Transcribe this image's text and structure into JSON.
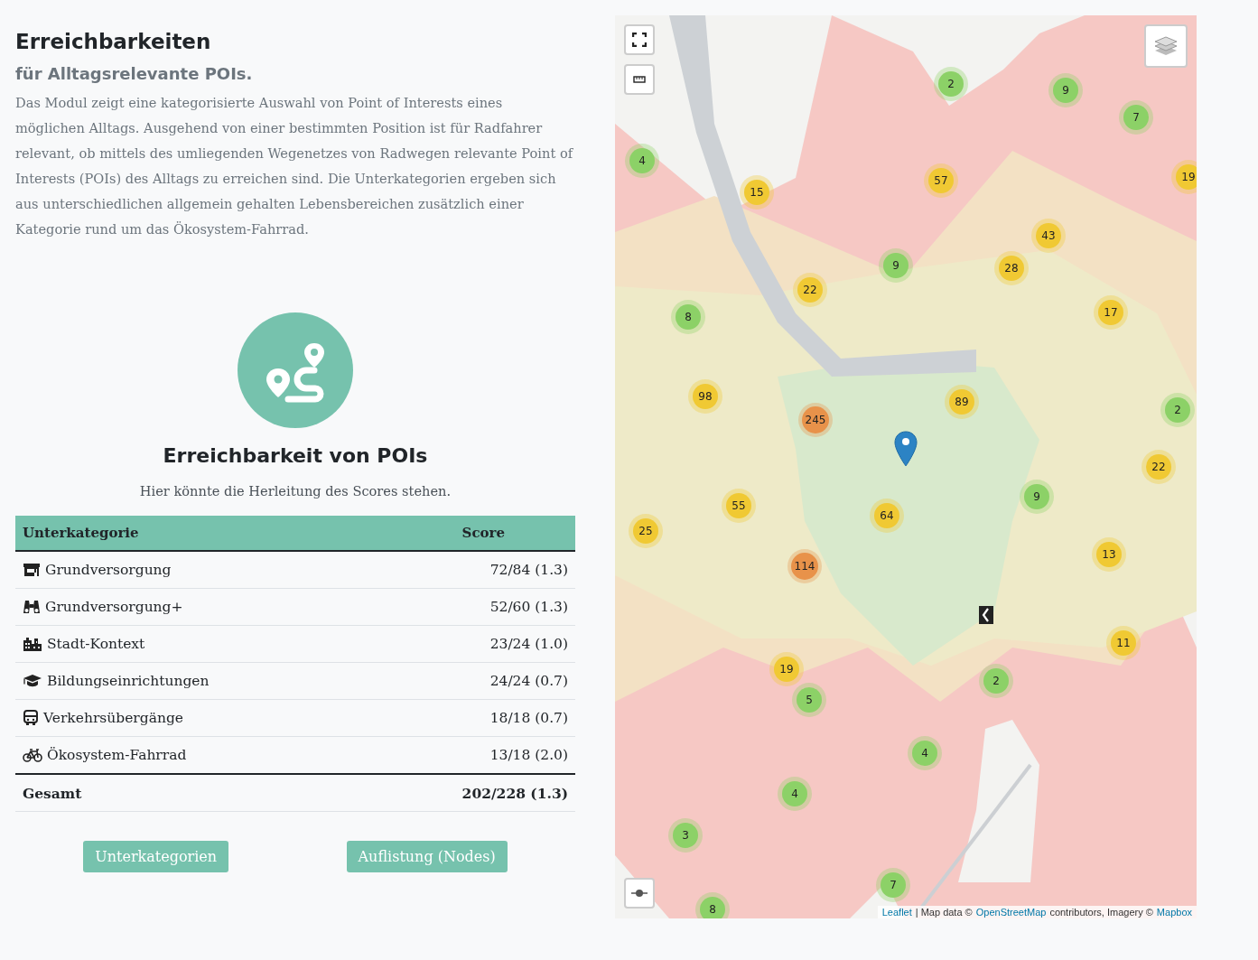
{
  "header": {
    "title": "Erreichbarkeiten",
    "subtitle": "für Alltagsrelevante POIs.",
    "description": "Das Modul zeigt eine kategorisierte Auswahl von Point of Interests eines möglichen Alltags. Ausgehend von einer bestimmten Position ist für Radfahrer relevant, ob mittels des umliegenden Wegenetzes von Radwegen relevante Point of Interests (POIs) des Alltags zu erreichen sind. Die Unterkategorien ergeben sich aus unterschiedlichen allgemein gehalten Lebensbereichen zusätzlich einer Kategorie rund um das Ökosystem-Fahrrad."
  },
  "score_card": {
    "title": "Erreichbarkeit von POIs",
    "note": "Hier könnte die Herleitung des Scores stehen."
  },
  "table": {
    "columns": [
      "Unterkategorie",
      "Score"
    ],
    "rows": [
      {
        "name": "Grundversorgung",
        "score": "72/84 (1.3)"
      },
      {
        "name": "Grundversorgung+",
        "score": "52/60 (1.3)"
      },
      {
        "name": "Stadt-Kontext",
        "score": "23/24 (1.0)"
      },
      {
        "name": "Bildungseinrichtungen",
        "score": "24/24 (0.7)"
      },
      {
        "name": "Verkehrsübergänge",
        "score": "18/18 (0.7)"
      },
      {
        "name": "Ökosystem-Fahrrad",
        "score": "13/18 (2.0)"
      }
    ],
    "total": {
      "name": "Gesamt",
      "score": "202/228 (1.3)"
    }
  },
  "buttons": [
    "Unterkategorien",
    "Auflistung (Nodes)"
  ],
  "map": {
    "clusters": [
      {
        "label": "2",
        "color": "#8cd167"
      },
      {
        "label": "9",
        "color": "#8cd167"
      },
      {
        "label": "7",
        "color": "#8cd167"
      },
      {
        "label": "4",
        "color": "#8cd167"
      },
      {
        "label": "15",
        "color": "#f0c933"
      },
      {
        "label": "57",
        "color": "#f0c933"
      },
      {
        "label": "19",
        "color": "#f0c933"
      },
      {
        "label": "43",
        "color": "#f0c933"
      },
      {
        "label": "9",
        "color": "#8cd167"
      },
      {
        "label": "28",
        "color": "#f0c933"
      },
      {
        "label": "22",
        "color": "#f0c933"
      },
      {
        "label": "8",
        "color": "#8cd167"
      },
      {
        "label": "17",
        "color": "#f0c933"
      },
      {
        "label": "98",
        "color": "#f0c933"
      },
      {
        "label": "245",
        "color": "#e8924a"
      },
      {
        "label": "89",
        "color": "#f0c933"
      },
      {
        "label": "2",
        "color": "#8cd167"
      },
      {
        "label": "22",
        "color": "#f0c933"
      },
      {
        "label": "9",
        "color": "#8cd167"
      },
      {
        "label": "55",
        "color": "#f0c933"
      },
      {
        "label": "64",
        "color": "#f0c933"
      },
      {
        "label": "25",
        "color": "#f0c933"
      },
      {
        "label": "13",
        "color": "#f0c933"
      },
      {
        "label": "114",
        "color": "#e8924a"
      },
      {
        "label": "11",
        "color": "#f0c933"
      },
      {
        "label": "19",
        "color": "#f0c933"
      },
      {
        "label": "5",
        "color": "#8cd167"
      },
      {
        "label": "2",
        "color": "#8cd167"
      },
      {
        "label": "4",
        "color": "#8cd167"
      },
      {
        "label": "4",
        "color": "#8cd167"
      },
      {
        "label": "3",
        "color": "#8cd167"
      },
      {
        "label": "7",
        "color": "#8cd167"
      },
      {
        "label": "8",
        "color": "#8cd167"
      }
    ],
    "attribution": [
      {
        "text": "Leaflet",
        "kind": "link"
      },
      {
        "text": "| Map data ©",
        "kind": "text"
      },
      {
        "text": "OpenStreetMap",
        "kind": "link"
      },
      {
        "text": "contributors, Imagery ©",
        "kind": "text"
      },
      {
        "text": "Mapbox",
        "kind": "link"
      }
    ]
  }
}
